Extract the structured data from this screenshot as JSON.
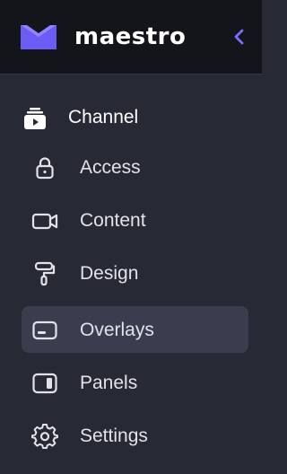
{
  "brand": {
    "name": "maestro",
    "logo_icon": "maestro-logo-icon",
    "accent_color": "#6c5cf6"
  },
  "header": {
    "collapse_icon": "chevron-left-icon"
  },
  "section": {
    "label": "Channel",
    "icon": "channel-icon"
  },
  "nav": {
    "items": [
      {
        "label": "Access",
        "icon": "lock-icon",
        "active": false
      },
      {
        "label": "Content",
        "icon": "video-camera-icon",
        "active": false
      },
      {
        "label": "Design",
        "icon": "paint-roller-icon",
        "active": false
      },
      {
        "label": "Overlays",
        "icon": "overlay-icon",
        "active": true
      },
      {
        "label": "Panels",
        "icon": "panel-icon",
        "active": false
      },
      {
        "label": "Settings",
        "icon": "gear-icon",
        "active": false
      }
    ]
  }
}
